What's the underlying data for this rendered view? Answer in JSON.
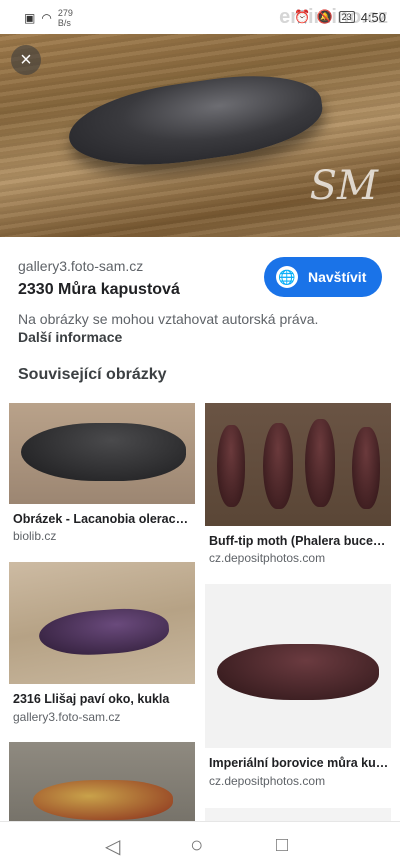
{
  "status_bar": {
    "speed_value": "279",
    "speed_unit": "B/s",
    "time": "4:50",
    "battery": "23",
    "watermark": "emimino.cz"
  },
  "viewer": {
    "close_label": "×",
    "source": "gallery3.foto-sam.cz",
    "title": "2330 Můra kapustová",
    "visit_label": "Navštívit",
    "copyright_note": "Na obrázky se mohou vztahovat autorská práva.",
    "more_info": "Další informace"
  },
  "related": {
    "heading": "Související obrázky",
    "items": [
      {
        "caption": "Obrázek - Lacanobia oleracea…",
        "domain": "biolib.cz"
      },
      {
        "caption": "Buff-tip moth (Phalera bucep…",
        "domain": "cz.depositphotos.com"
      },
      {
        "caption": "2316 Llišaj paví oko, kukla",
        "domain": "gallery3.foto-sam.cz"
      },
      {
        "caption": "Imperiální borovice můra kukl…",
        "domain": "cz.depositphotos.com"
      }
    ]
  },
  "nav": {
    "back": "◁",
    "home": "○",
    "recents": "□"
  }
}
